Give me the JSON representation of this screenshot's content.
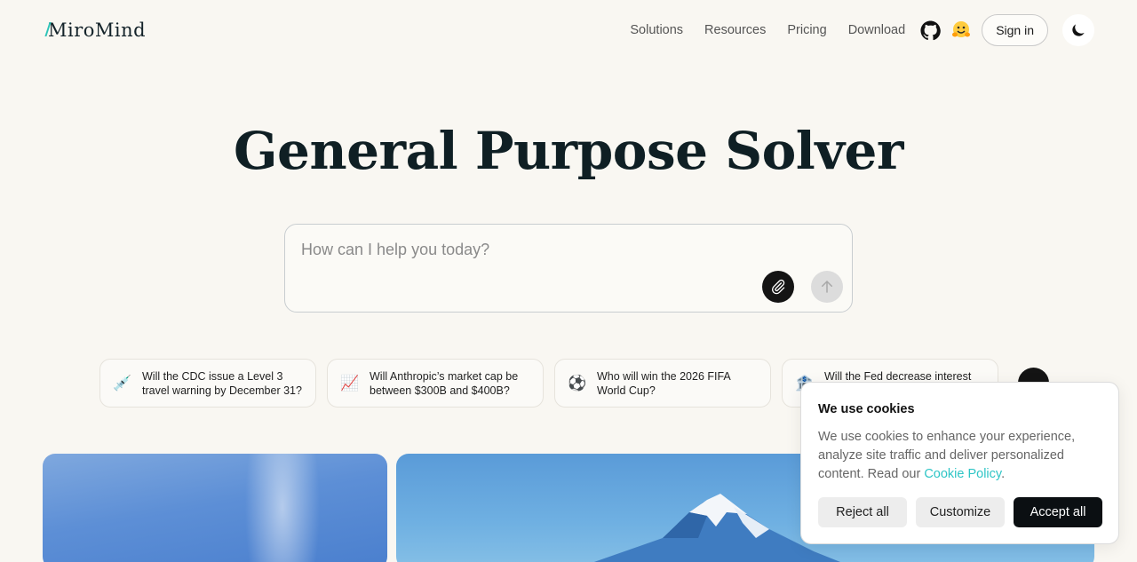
{
  "brand": {
    "logo_text": "MiroMind"
  },
  "nav": {
    "links": [
      "Solutions",
      "Resources",
      "Pricing",
      "Download"
    ],
    "github_icon": "github-icon",
    "huggingface_icon": "hugging-face-icon",
    "sign_in_label": "Sign in",
    "theme_icon": "moon-icon"
  },
  "hero": {
    "title": "General Purpose Solver"
  },
  "prompt": {
    "placeholder": "How can I help you today?",
    "attach_icon": "paperclip-icon",
    "send_icon": "arrow-up-icon"
  },
  "suggestions": [
    {
      "emoji": "💉",
      "text": "Will the CDC issue a Level 3 travel warning by December 31?"
    },
    {
      "emoji": "📈",
      "text": "Will Anthropic’s market cap be between $300B and $400B?"
    },
    {
      "emoji": "⚽",
      "text": "Who will win the 2026 FIFA World Cup?"
    },
    {
      "emoji": "🏦",
      "text": "Will the Fed decrease interest rates?"
    }
  ],
  "cookie": {
    "title": "We use cookies",
    "body": "We use cookies to enhance your experience, analyze site traffic and deliver personalized content. Read our ",
    "link": "Cookie Policy",
    "end": ".",
    "reject_label": "Reject all",
    "customize_label": "Customize",
    "accept_label": "Accept all"
  },
  "colors": {
    "background": "#f9f7f2",
    "accent": "#2ec5c6",
    "primary_dark": "#0b0f12"
  }
}
